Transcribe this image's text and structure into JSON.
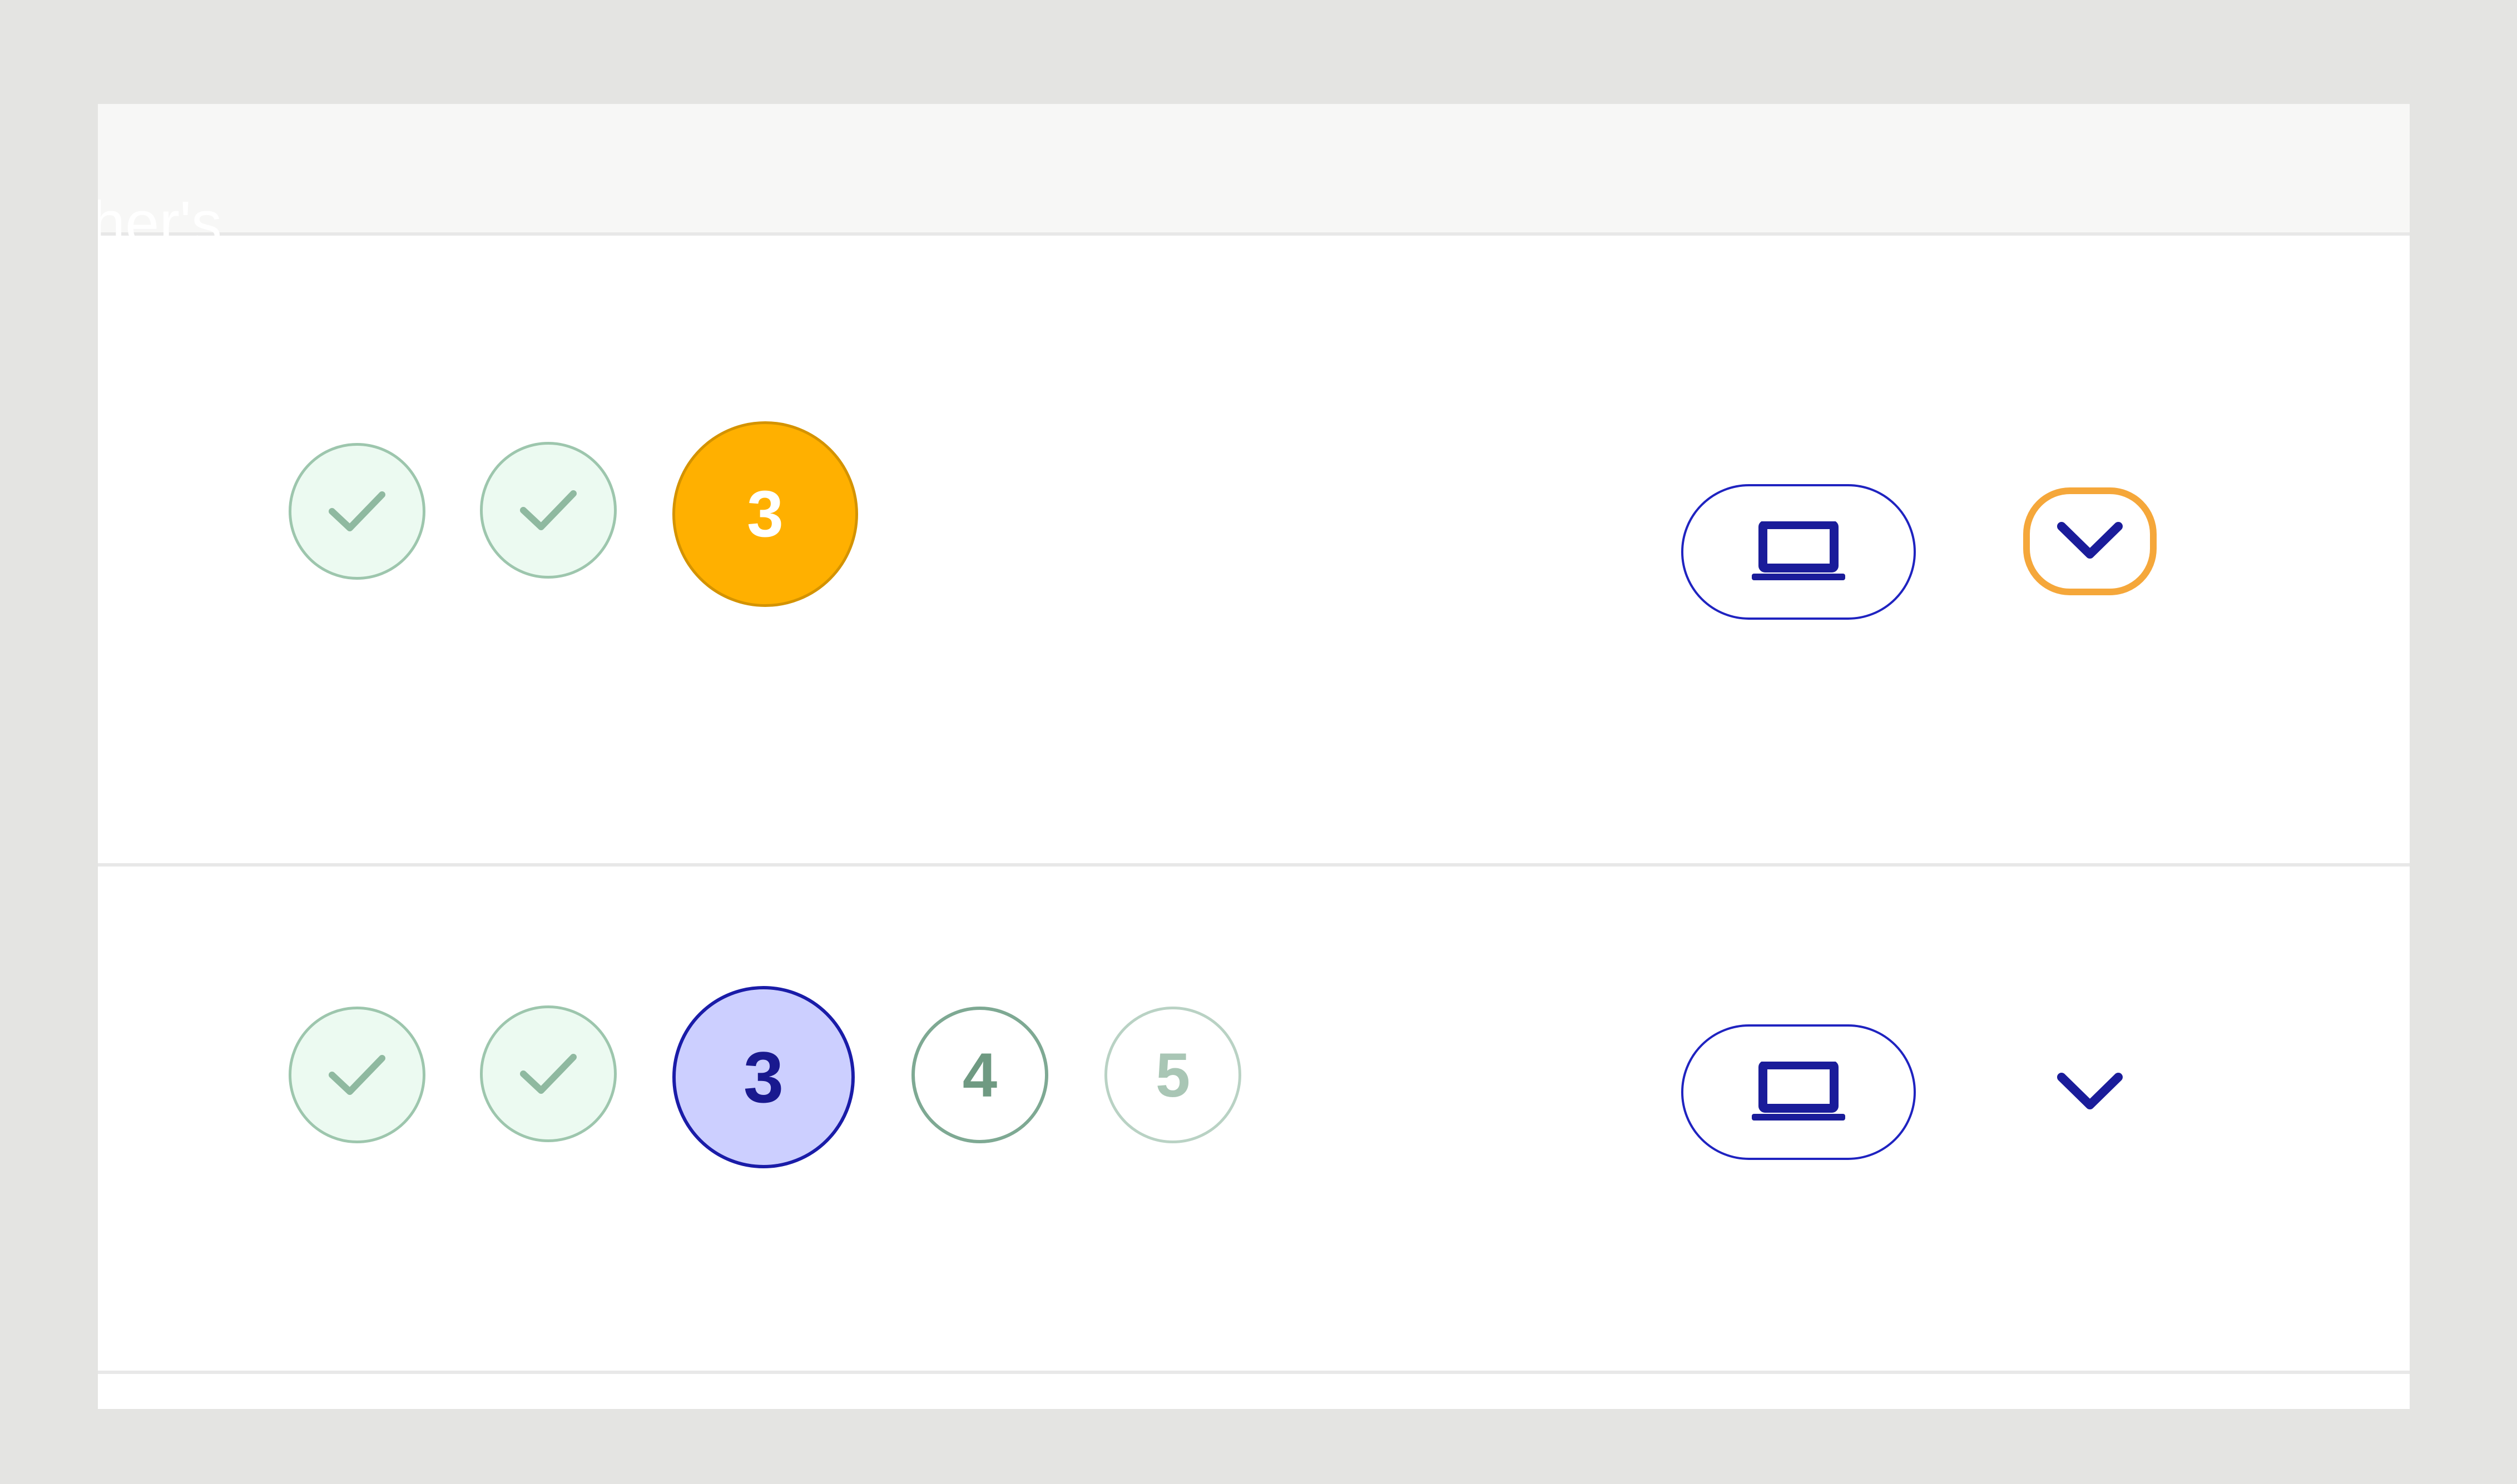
{
  "header": {
    "column_label": "her's"
  },
  "rows": [
    {
      "steps": [
        {
          "state": "done",
          "icon": "check-icon"
        },
        {
          "state": "done",
          "icon": "check-icon"
        },
        {
          "state": "current-warning",
          "label": "3"
        }
      ],
      "device_icon": "laptop-icon",
      "toggle_icon": "chevron-down-icon",
      "toggle_focused": true
    },
    {
      "steps": [
        {
          "state": "done",
          "icon": "check-icon"
        },
        {
          "state": "done",
          "icon": "check-icon"
        },
        {
          "state": "current",
          "label": "3"
        },
        {
          "state": "next",
          "label": "4"
        },
        {
          "state": "upcoming",
          "label": "5"
        }
      ],
      "device_icon": "laptop-icon",
      "toggle_icon": "chevron-down-icon",
      "toggle_focused": false
    }
  ],
  "colors": {
    "accent": "#1f23c0",
    "warning": "#ffb000",
    "done_fill": "#ecfaf1",
    "done_border": "#9dc6ad",
    "focus_ring": "#f5a73a",
    "active_fill": "#cccfff"
  }
}
